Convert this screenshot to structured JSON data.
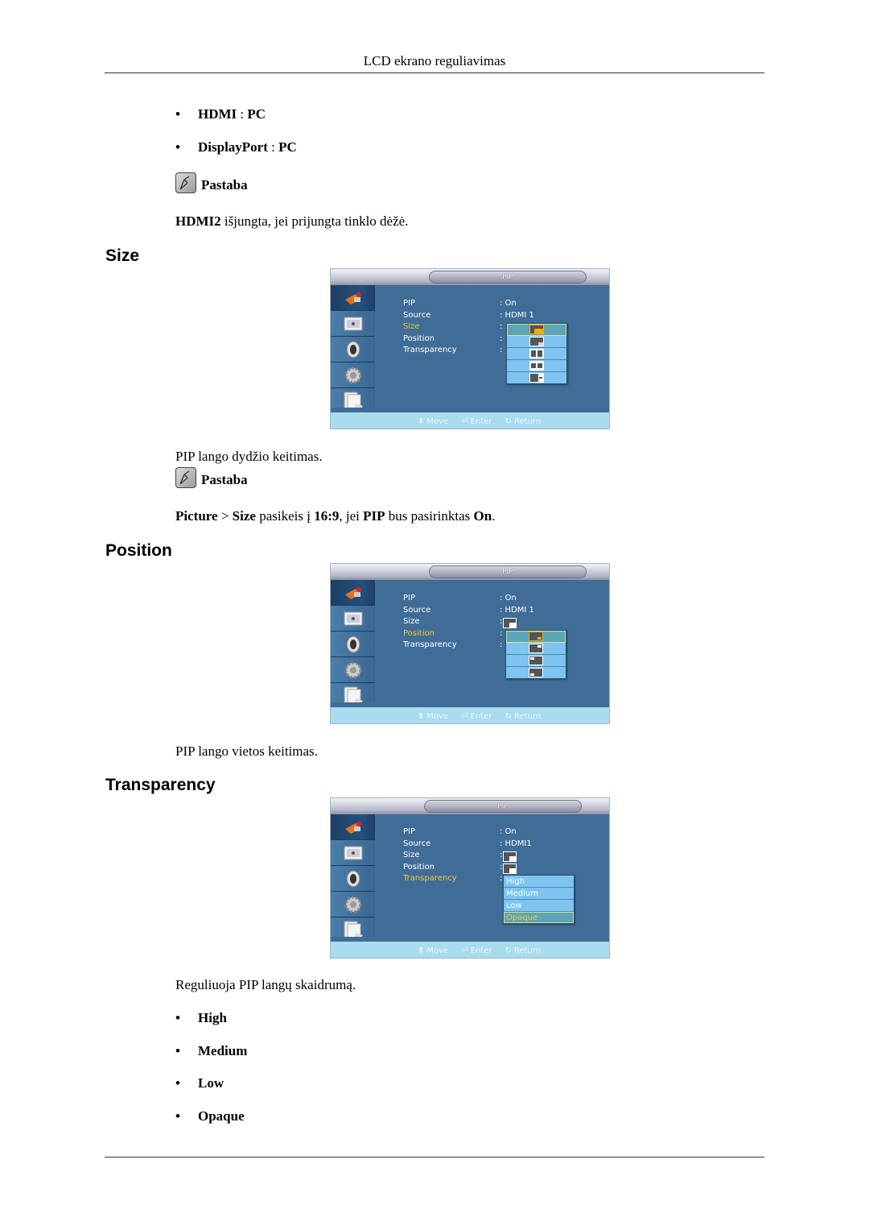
{
  "header": {
    "running_title": "LCD ekrano reguliavimas"
  },
  "intro": {
    "bullets": [
      {
        "bold": "HDMI",
        "sep": " : ",
        "value": "PC"
      },
      {
        "bold": "DisplayPort",
        "sep": " : ",
        "value": "PC"
      }
    ],
    "note": {
      "label": "Pastaba",
      "bold": "HDMI2",
      "text": " išjungta, jei prijungta tinklo dėžė."
    }
  },
  "sections": {
    "size": {
      "heading": "Size",
      "osd": {
        "title": "PIP",
        "menu": [
          {
            "label": "PIP",
            "value": ": On"
          },
          {
            "label": "Source",
            "value": ": HDMI 1"
          },
          {
            "label": "Size",
            "value": ":"
          },
          {
            "label": "Position",
            "value": ":"
          },
          {
            "label": "Transparency",
            "value": ":"
          }
        ],
        "selected_item": "Size",
        "dropdown_icons": [
          "pip-size-large-icon",
          "pip-size-small-icon",
          "pip-split-equal-icon",
          "pip-split-small-icon",
          "pip-side-small-icon"
        ],
        "dropdown_selected_index": 0,
        "hints": {
          "move": "Move",
          "enter": "Enter",
          "return": "Return"
        }
      },
      "description": "PIP lango dydžio keitimas.",
      "note": {
        "label": "Pastaba",
        "parts": [
          {
            "t": "Picture",
            "b": true
          },
          {
            "t": " > ",
            "b": false
          },
          {
            "t": "Size",
            "b": true
          },
          {
            "t": " pasikeis į ",
            "b": false
          },
          {
            "t": "16:9",
            "b": true
          },
          {
            "t": ", jei ",
            "b": false
          },
          {
            "t": "PIP",
            "b": true
          },
          {
            "t": " bus pasirinktas ",
            "b": false
          },
          {
            "t": "On",
            "b": true
          },
          {
            "t": ".",
            "b": false
          }
        ]
      }
    },
    "position": {
      "heading": "Position",
      "osd": {
        "title": "PIP",
        "menu": [
          {
            "label": "PIP",
            "value": ": On"
          },
          {
            "label": "Source",
            "value": ": HDMI 1"
          },
          {
            "label": "Size",
            "value": ":"
          },
          {
            "label": "Position",
            "value": ":"
          },
          {
            "label": "Transparency",
            "value": ":"
          }
        ],
        "selected_item": "Position",
        "dropdown_icons": [
          "pip-bottom-right-icon",
          "pip-top-right-icon",
          "pip-top-left-icon",
          "pip-bottom-left-icon"
        ],
        "dropdown_selected_index": 0,
        "hints": {
          "move": "Move",
          "enter": "Enter",
          "return": "Return"
        }
      },
      "description": "PIP lango vietos keitimas."
    },
    "transparency": {
      "heading": "Transparency",
      "osd": {
        "title": "PIP",
        "menu": [
          {
            "label": "PIP",
            "value": ": On"
          },
          {
            "label": "Source",
            "value": ": HDMI1"
          },
          {
            "label": "Size",
            "value": ":"
          },
          {
            "label": "Position",
            "value": ":"
          },
          {
            "label": "Transparency",
            "value": ":"
          }
        ],
        "selected_item": "Transparency",
        "dropdown_options": [
          "High",
          "Medium",
          "Low",
          "Opaque"
        ],
        "dropdown_selected_index": 3,
        "hints": {
          "move": "Move",
          "enter": "Enter",
          "return": "Return"
        }
      },
      "description": "Reguliuoja PIP langų skaidrumą.",
      "options": [
        "High",
        "Medium",
        "Low",
        "Opaque"
      ]
    }
  },
  "colors": {
    "osd_background": "#3f6d97",
    "osd_selected_text": "#f2c33a",
    "osd_dropdown": "#7dc4f0",
    "osd_footer": "#a9dcee"
  }
}
